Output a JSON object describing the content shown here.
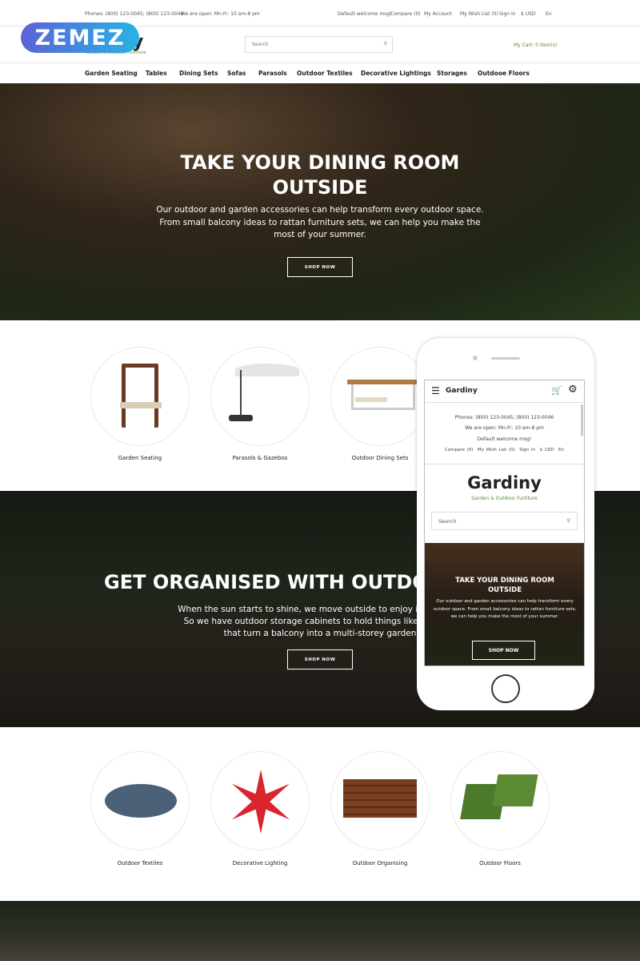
{
  "topbar": {
    "phones": "Phones: (800) 123-0045; (800) 123-0046",
    "hours": "We are open: Mn-Fr: 10 am-8 pm",
    "welcome": "Default welcome msg!",
    "compare": "Compare (0)",
    "account": "My Account",
    "wishlist": "My Wish List (0)",
    "signin": "Sign In",
    "currency": "$ USD",
    "language": "En"
  },
  "header": {
    "watermark": "ZEMEZ",
    "logo_partial": "y",
    "tagline": "Garden & Outdoor Furtiture",
    "search_placeholder": "Search",
    "cart": "My Cart: 0 item(s)"
  },
  "nav": [
    "Garden Seating",
    "Tables",
    "Dining Sets",
    "Sofas",
    "Parasols",
    "Outdoor Textiles",
    "Decorative Lightings",
    "Storages",
    "Outdooe Floors"
  ],
  "hero": {
    "title": "TAKE YOUR DINING ROOM OUTSIDE",
    "text": "Our outdoor and garden accessories can help transform every outdoor space. From small balcony ideas to rattan furniture sets, we can help you make the most of your summer.",
    "button": "SHOP NOW"
  },
  "categories1": [
    "Garden Seating",
    "Parasols & Gazebos",
    "Outdoor Dining Sets"
  ],
  "banner2": {
    "title": "GET ORGANISED WITH OUTDOO",
    "line1": "When the sun starts to shine, we move outside to enjoy it. And so c",
    "line2": "So we have outdoor storage cabinets to hold things like garden t",
    "line3": "that turn a balcony into a multi-storey garden",
    "button": "SHOP NOW"
  },
  "categories2": [
    "Outdoor Textiles",
    "Decorative Lighting",
    "Outdoor Organising",
    "Outdoor Floors"
  ],
  "mobile": {
    "brand": "Gardiny",
    "phones": "Phones: (800) 123-0045; (800) 123-0046",
    "hours": "We are open: Mn-Fr: 10 am-8 pm",
    "welcome": "Default welcome msg!",
    "links": [
      "Compare (0)",
      "My Wish List (0)",
      "Sign In",
      "$ USD",
      "En"
    ],
    "logo": "Gardiny",
    "tagline": "Garden & Outdoor Furtiture",
    "search_placeholder": "Search",
    "hero_title": "TAKE YOUR DINING ROOM OUTSIDE",
    "hero_text": "Our outdoor and garden accessories can help transform every outdoor space. From small balcony ideas to rattan furniture sets, we can help you make the most of your summer.",
    "button": "SHOP NOW"
  },
  "colors": {
    "accent_green": "#5a8a3c",
    "watermark_start": "#5b63d6",
    "watermark_end": "#27b3e6"
  }
}
